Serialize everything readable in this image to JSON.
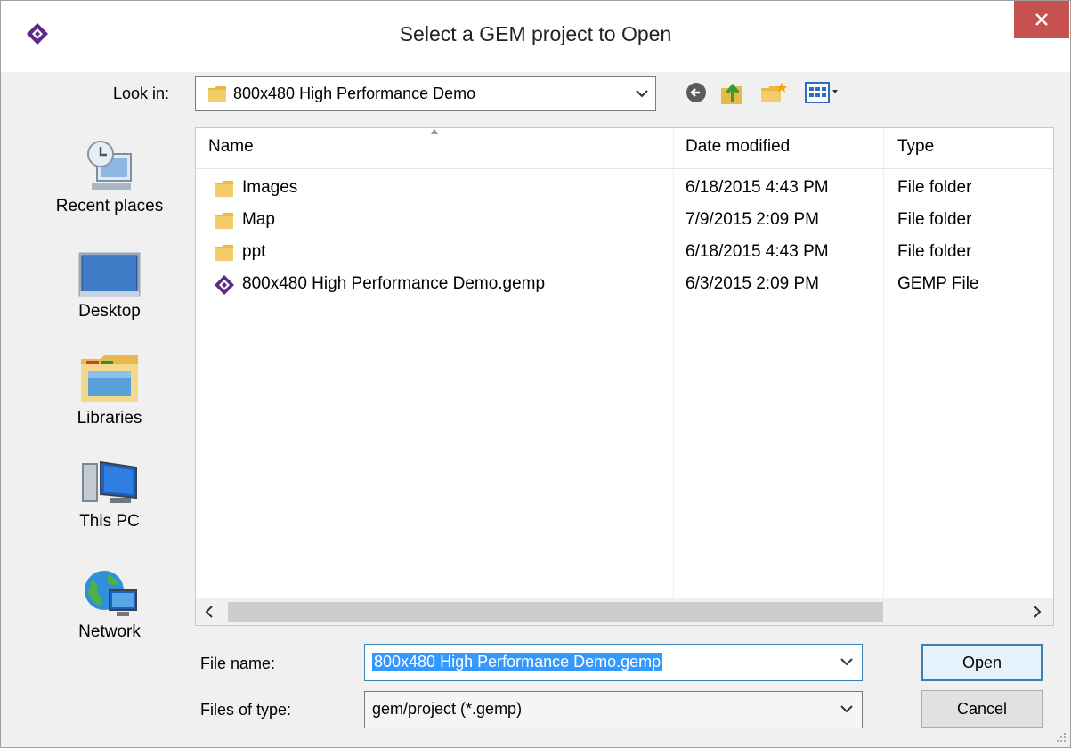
{
  "window": {
    "title": "Select a GEM project to Open"
  },
  "look_in": {
    "label": "Look in:",
    "value": "800x480 High Performance Demo"
  },
  "toolbar": {
    "back": "back-icon",
    "up": "up-folder-icon",
    "new_folder": "new-folder-icon",
    "view_menu": "view-menu-icon"
  },
  "places": [
    {
      "label": "Recent places",
      "icon": "recent-places-icon"
    },
    {
      "label": "Desktop",
      "icon": "desktop-icon"
    },
    {
      "label": "Libraries",
      "icon": "libraries-icon"
    },
    {
      "label": "This PC",
      "icon": "this-pc-icon"
    },
    {
      "label": "Network",
      "icon": "network-icon"
    }
  ],
  "columns": [
    "Name",
    "Date modified",
    "Type"
  ],
  "files": [
    {
      "name": "Images",
      "date": "6/18/2015 4:43 PM",
      "type": "File folder",
      "icon": "folder-icon"
    },
    {
      "name": "Map",
      "date": "7/9/2015 2:09 PM",
      "type": "File folder",
      "icon": "folder-icon"
    },
    {
      "name": "ppt",
      "date": "6/18/2015 4:43 PM",
      "type": "File folder",
      "icon": "folder-icon"
    },
    {
      "name": "800x480 High Performance Demo.gemp",
      "date": "6/3/2015 2:09 PM",
      "type": "GEMP File",
      "icon": "gemp-file-icon"
    }
  ],
  "form": {
    "file_name_label": "File name:",
    "file_name_value": "800x480 High Performance Demo.gemp",
    "file_type_label": "Files of type:",
    "file_type_value": "gem/project (*.gemp)"
  },
  "buttons": {
    "open": "Open",
    "cancel": "Cancel"
  },
  "colors": {
    "accent": "#3399ff",
    "close": "#c75050",
    "brand": "#5b2a86"
  }
}
